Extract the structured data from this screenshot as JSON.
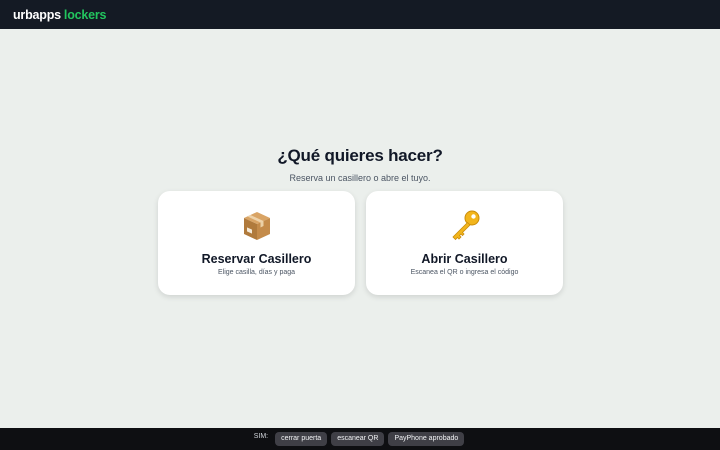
{
  "brand": {
    "part1": "urbapps",
    "part2": "lockers",
    "accent_color": "#22c55e"
  },
  "hero": {
    "title": "¿Qué quieres hacer?",
    "subtitle": "Reserva un casillero o abre el tuyo."
  },
  "cards": [
    {
      "icon": "package-box-icon",
      "title": "Reservar Casillero",
      "subtitle": "Elige casilla, días y paga"
    },
    {
      "icon": "key-icon",
      "title": "Abrir Casillero",
      "subtitle": "Escanea el QR o ingresa el código"
    }
  ],
  "sim": {
    "label": "SIM:",
    "buttons": [
      "cerrar puerta",
      "escanear QR",
      "PayPhone aprobado"
    ]
  }
}
